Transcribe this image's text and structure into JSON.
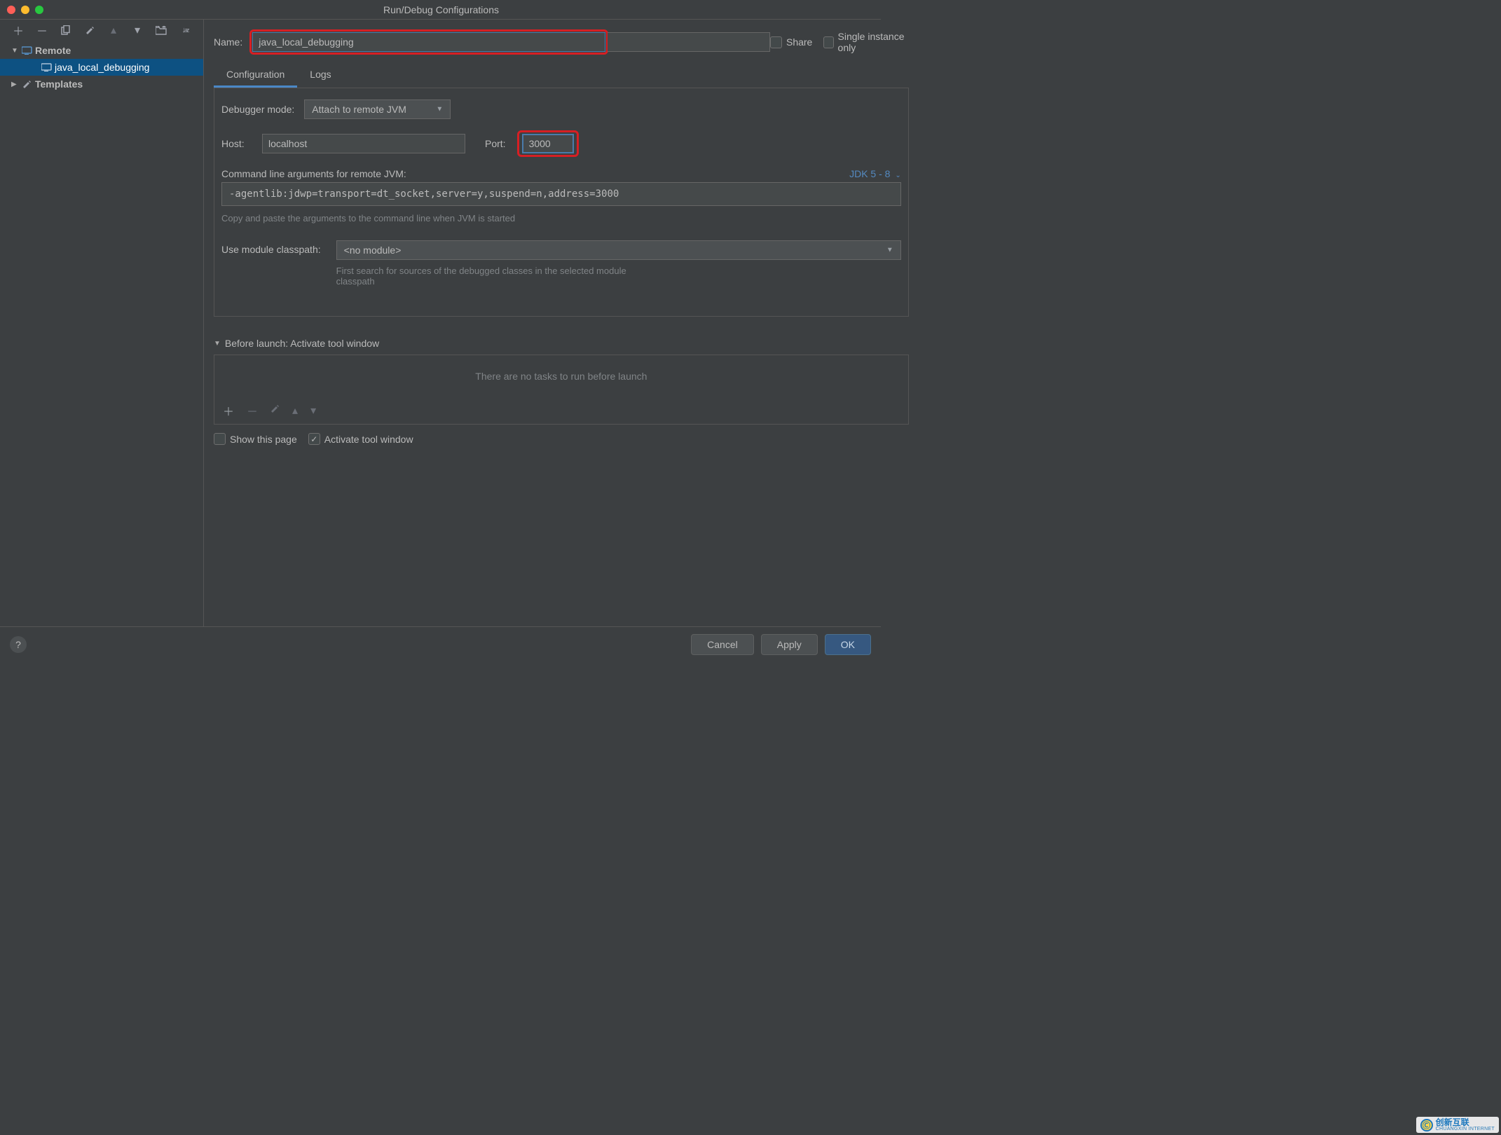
{
  "window": {
    "title": "Run/Debug Configurations"
  },
  "sidebar": {
    "nodes": {
      "remote": "Remote",
      "config_item": "java_local_debugging",
      "templates": "Templates"
    }
  },
  "form": {
    "name_label": "Name:",
    "name_value": "java_local_debugging",
    "share_label": "Share",
    "single_instance_label": "Single instance only"
  },
  "tabs": {
    "configuration": "Configuration",
    "logs": "Logs"
  },
  "config": {
    "debugger_mode_label": "Debugger mode:",
    "debugger_mode_value": "Attach to remote JVM",
    "host_label": "Host:",
    "host_value": "localhost",
    "port_label": "Port:",
    "port_value": "3000",
    "cmd_label": "Command line arguments for remote JVM:",
    "jdk_link": "JDK 5 - 8",
    "cmd_value": "-agentlib:jdwp=transport=dt_socket,server=y,suspend=n,address=3000",
    "cmd_hint": "Copy and paste the arguments to the command line when JVM is started",
    "module_label": "Use module classpath:",
    "module_value": "<no module>",
    "module_hint": "First search for sources of the debugged classes in the selected module classpath"
  },
  "before_launch": {
    "header": "Before launch: Activate tool window",
    "empty": "There are no tasks to run before launch",
    "show_this_page": "Show this page",
    "activate_tool_window": "Activate tool window"
  },
  "footer": {
    "cancel": "Cancel",
    "apply": "Apply",
    "ok": "OK"
  },
  "watermark": {
    "title": "创新互联",
    "sub": "CHUANGXIN INTERNET"
  }
}
